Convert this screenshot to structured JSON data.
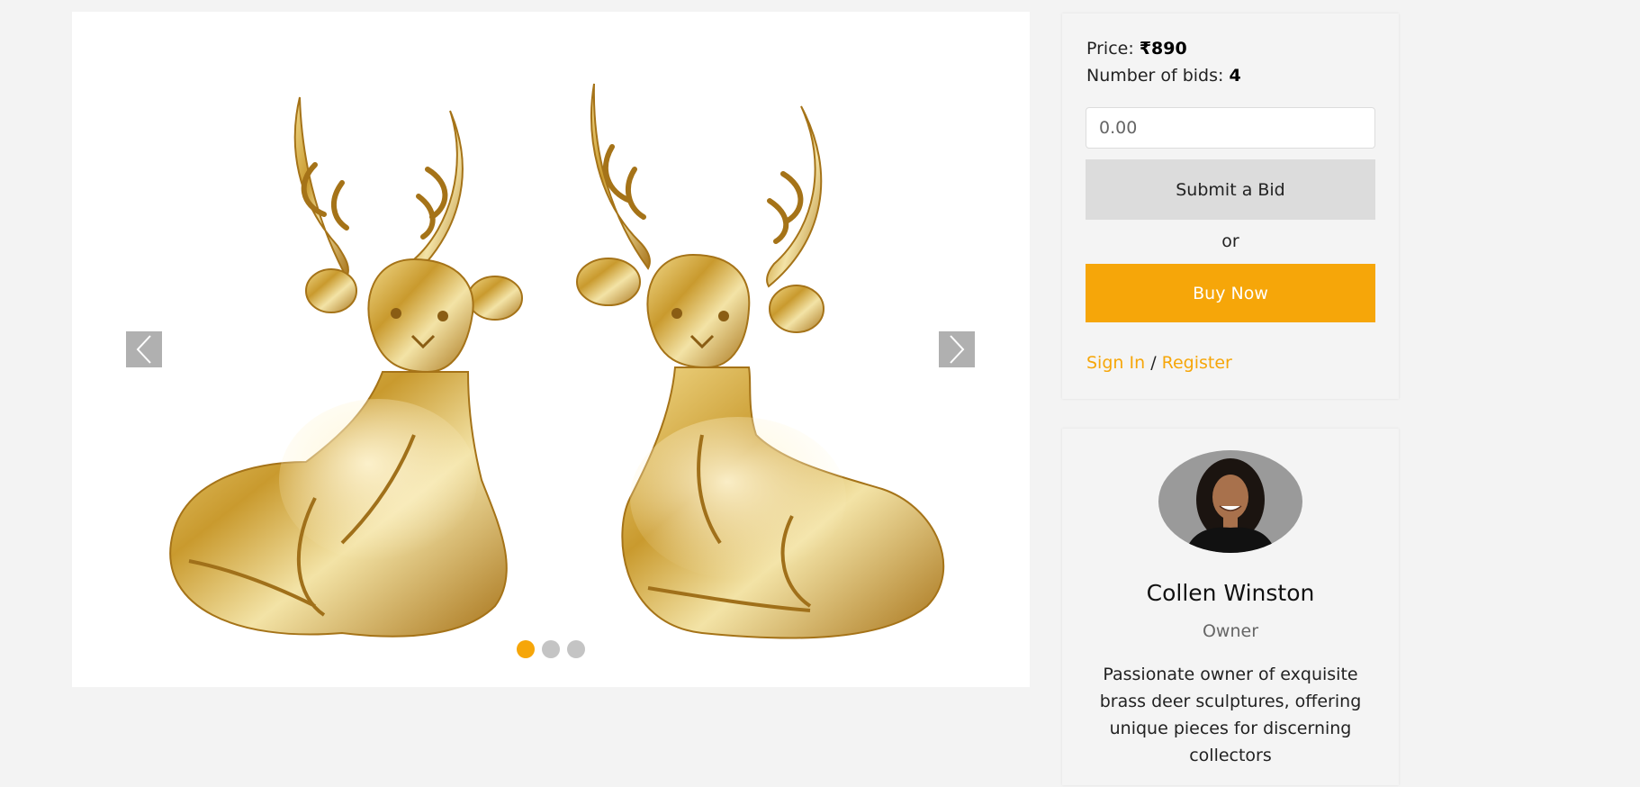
{
  "gallery": {
    "prev_icon": "chevron-left-icon",
    "next_icon": "chevron-right-icon",
    "slides": 3,
    "active_slide": 1,
    "image": "brass-deer-pair"
  },
  "bid": {
    "price_label": "Price:",
    "price_value": "₹890",
    "bids_label": "Number of bids:",
    "bids_value": "4",
    "input_placeholder": "0.00",
    "submit_label": "Submit a Bid",
    "or_text": "or",
    "buy_label": "Buy Now",
    "signin_label": "Sign In",
    "separator": "/",
    "register_label": "Register"
  },
  "owner": {
    "name": "Collen Winston",
    "role": "Owner",
    "bio": "Passionate owner of exquisite brass deer sculptures, offering unique pieces for discerning collectors"
  },
  "colors": {
    "accent": "#f6a609",
    "background": "#f3f3f3",
    "card": "#f4f4f4",
    "bid_button": "#dcdcdc"
  }
}
